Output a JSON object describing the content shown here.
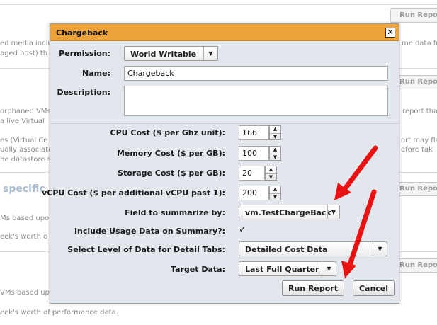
{
  "background": {
    "run_report_label": "Run Repor",
    "texts": [
      "ed media includ",
      "aged host) th",
      "me data fr",
      "orphaned VMs",
      "a live Virtual",
      "report tha",
      "es (Virtual Ce",
      "ually associate",
      "he datastore s",
      "ort may fla",
      "efore tak",
      "Ms based upo",
      "eek's worth o",
      "VMs based upo",
      "eek's worth of performance data."
    ],
    "heading": "specific"
  },
  "dialog": {
    "title": "Chargeback",
    "close_symbol": "✕",
    "permission_label": "Permission:",
    "permission_value": "World Writable",
    "name_label": "Name:",
    "name_value": "Chargeback",
    "description_label": "Description:",
    "description_value": "",
    "cpu_cost_label": "CPU Cost ($ per Ghz unit):",
    "cpu_cost_value": "166",
    "memory_cost_label": "Memory Cost ($ per GB):",
    "memory_cost_value": "100",
    "storage_cost_label": "Storage Cost ($ per GB):",
    "storage_cost_value": "20",
    "vcpu_cost_label": "vCPU Cost ($ per additional vCPU past 1):",
    "vcpu_cost_value": "200",
    "summarize_field_label": "Field to summarize by:",
    "summarize_field_value": "vm.TestChargeBack",
    "include_usage_label": "Include Usage Data on Summary?:",
    "include_usage_checked": "✓",
    "detail_level_label": "Select Level of Data for Detail Tabs:",
    "detail_level_value": "Detailed Cost Data",
    "target_data_label": "Target Data:",
    "target_data_value": "Last Full Quarter",
    "run_report_button": "Run Report",
    "cancel_button": "Cancel",
    "dropdown_arrow": "▼",
    "spin_up": "▲",
    "spin_down": "▼"
  },
  "colors": {
    "titlebar": "#eda33a",
    "dialog_bg": "#e2e7ee",
    "annotation_arrow": "#e81212"
  }
}
